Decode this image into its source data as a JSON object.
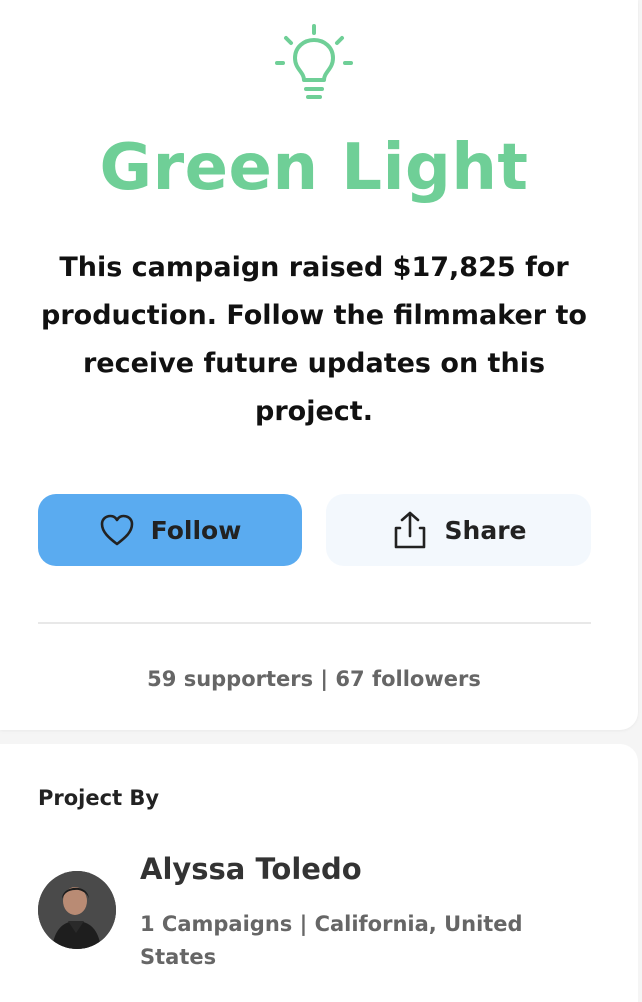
{
  "campaign": {
    "status_icon": "lightbulb-icon",
    "status_title": "Green Light",
    "description": "This campaign raised $17,825 for production. Follow the filmmaker to receive future updates on this project.",
    "accent_color": "#6fcf97"
  },
  "actions": {
    "follow_label": "Follow",
    "follow_icon": "heart-icon",
    "follow_color": "#5aabf0",
    "share_label": "Share",
    "share_icon": "share-icon"
  },
  "stats": {
    "text": "59 supporters | 67 followers"
  },
  "creator": {
    "section_label": "Project By",
    "name": "Alyssa Toledo",
    "meta": "1 Campaigns | California, United States"
  }
}
